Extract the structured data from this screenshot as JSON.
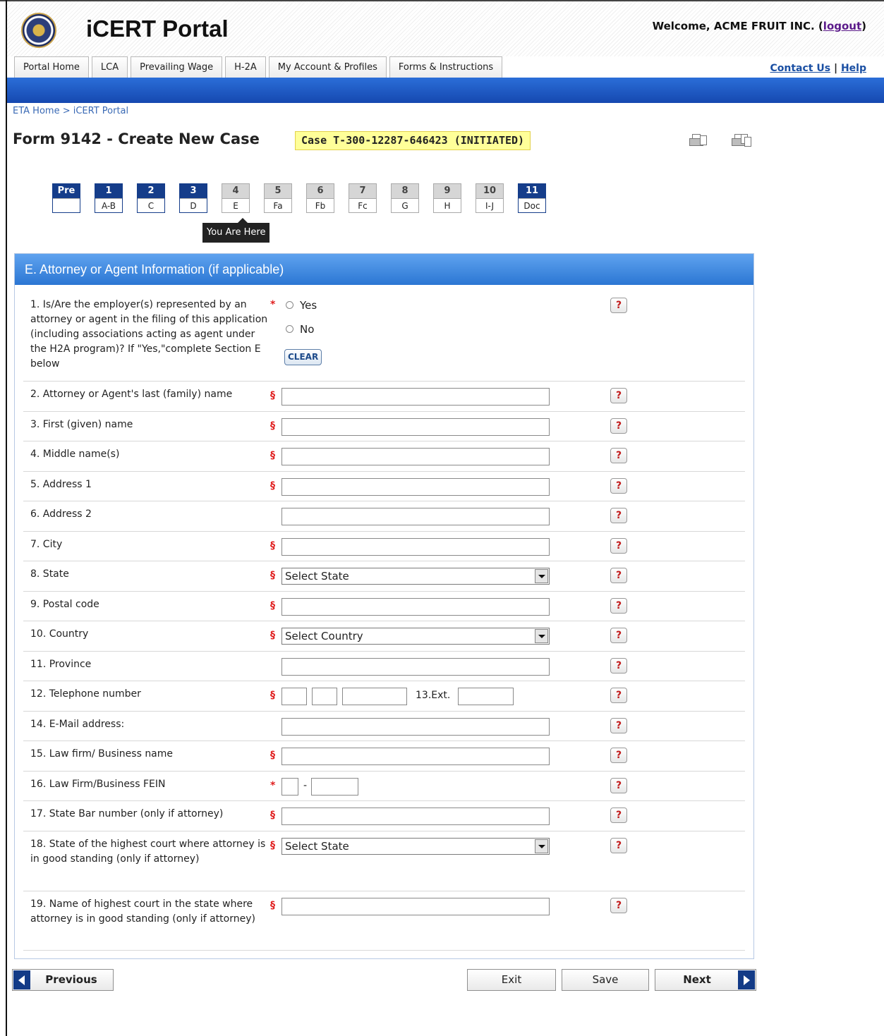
{
  "app": {
    "title": "iCERT Portal",
    "welcome_prefix": "Welcome, ACME FRUIT INC. (",
    "logout": "logout",
    "welcome_suffix": ")"
  },
  "nav": {
    "tabs": [
      "Portal Home",
      "LCA",
      "Prevailing Wage",
      "H-2A",
      "My Account & Profiles",
      "Forms & Instructions"
    ],
    "contact": "Contact Us",
    "separator": " | ",
    "help": "Help"
  },
  "breadcrumb": "ETA Home  > iCERT Portal",
  "page": {
    "title": "Form 9142 - Create New Case",
    "case_badge": "Case T-300-12287-646423 (INITIATED)"
  },
  "steps": [
    {
      "num": "Pre",
      "label": "",
      "state": "done"
    },
    {
      "num": "1",
      "label": "A-B",
      "state": "done"
    },
    {
      "num": "2",
      "label": "C",
      "state": "done"
    },
    {
      "num": "3",
      "label": "D",
      "state": "done"
    },
    {
      "num": "4",
      "label": "E",
      "state": "todo"
    },
    {
      "num": "5",
      "label": "Fa",
      "state": "todo"
    },
    {
      "num": "6",
      "label": "Fb",
      "state": "todo"
    },
    {
      "num": "7",
      "label": "Fc",
      "state": "todo"
    },
    {
      "num": "8",
      "label": "G",
      "state": "todo"
    },
    {
      "num": "9",
      "label": "H",
      "state": "todo"
    },
    {
      "num": "10",
      "label": "I-J",
      "state": "todo"
    },
    {
      "num": "11",
      "label": "Doc",
      "state": "done"
    }
  ],
  "you_are_here": "You Are Here",
  "section": {
    "title": "E. Attorney or Agent Information (if applicable)",
    "q1": {
      "label": "1. Is/Are the employer(s) represented by an attorney or agent in the filing of this application (including associations acting as agent under the H2A program)? If \"Yes,\"complete Section E below",
      "mark": "*",
      "yes": "Yes",
      "no": "No",
      "clear": "CLEAR"
    },
    "fields": [
      {
        "label": "2. Attorney or Agent's last (family) name",
        "mark": "§"
      },
      {
        "label": "3. First (given) name",
        "mark": "§"
      },
      {
        "label": "4. Middle name(s)",
        "mark": "§"
      },
      {
        "label": "5. Address 1",
        "mark": "§"
      },
      {
        "label": "6. Address 2",
        "mark": ""
      },
      {
        "label": "7. City",
        "mark": "§"
      },
      {
        "label": "8. State",
        "mark": "§",
        "select": "Select State"
      },
      {
        "label": "9. Postal code",
        "mark": "§"
      },
      {
        "label": "10. Country",
        "mark": "§",
        "select": "Select Country"
      },
      {
        "label": "11. Province",
        "mark": ""
      },
      {
        "label": "12. Telephone number",
        "mark": "§",
        "ext_label": "13.Ext."
      },
      {
        "label": "14. E-Mail address:",
        "mark": ""
      },
      {
        "label": "15. Law firm/ Business name",
        "mark": "§"
      },
      {
        "label": "16. Law Firm/Business FEIN",
        "mark": "*",
        "dash": "-"
      },
      {
        "label": "17. State Bar number (only if attorney)",
        "mark": "§"
      },
      {
        "label": "18. State of the highest court where attorney is in good standing (only if attorney)",
        "mark": "§",
        "select": "Select State"
      },
      {
        "label": "19. Name of highest court in the state where attorney is in good standing (only if attorney)",
        "mark": "§"
      }
    ],
    "help_glyph": "?"
  },
  "footer": {
    "previous": "Previous",
    "exit": "Exit",
    "save": "Save",
    "next": "Next"
  }
}
